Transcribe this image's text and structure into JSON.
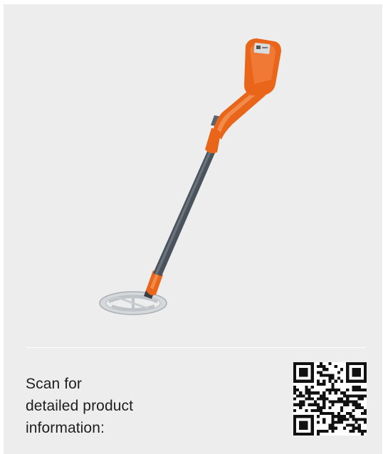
{
  "product": {
    "image_name": "metal-detector",
    "colors": {
      "background": "#ededed",
      "housing": "#e8651a",
      "shaft": "#4a535c",
      "coil": "#c8cdd1"
    }
  },
  "scan_text": {
    "line1": "Scan for",
    "line2": "detailed product",
    "line3": "information:"
  },
  "qr_code": {
    "icon": "qr-code-icon"
  }
}
